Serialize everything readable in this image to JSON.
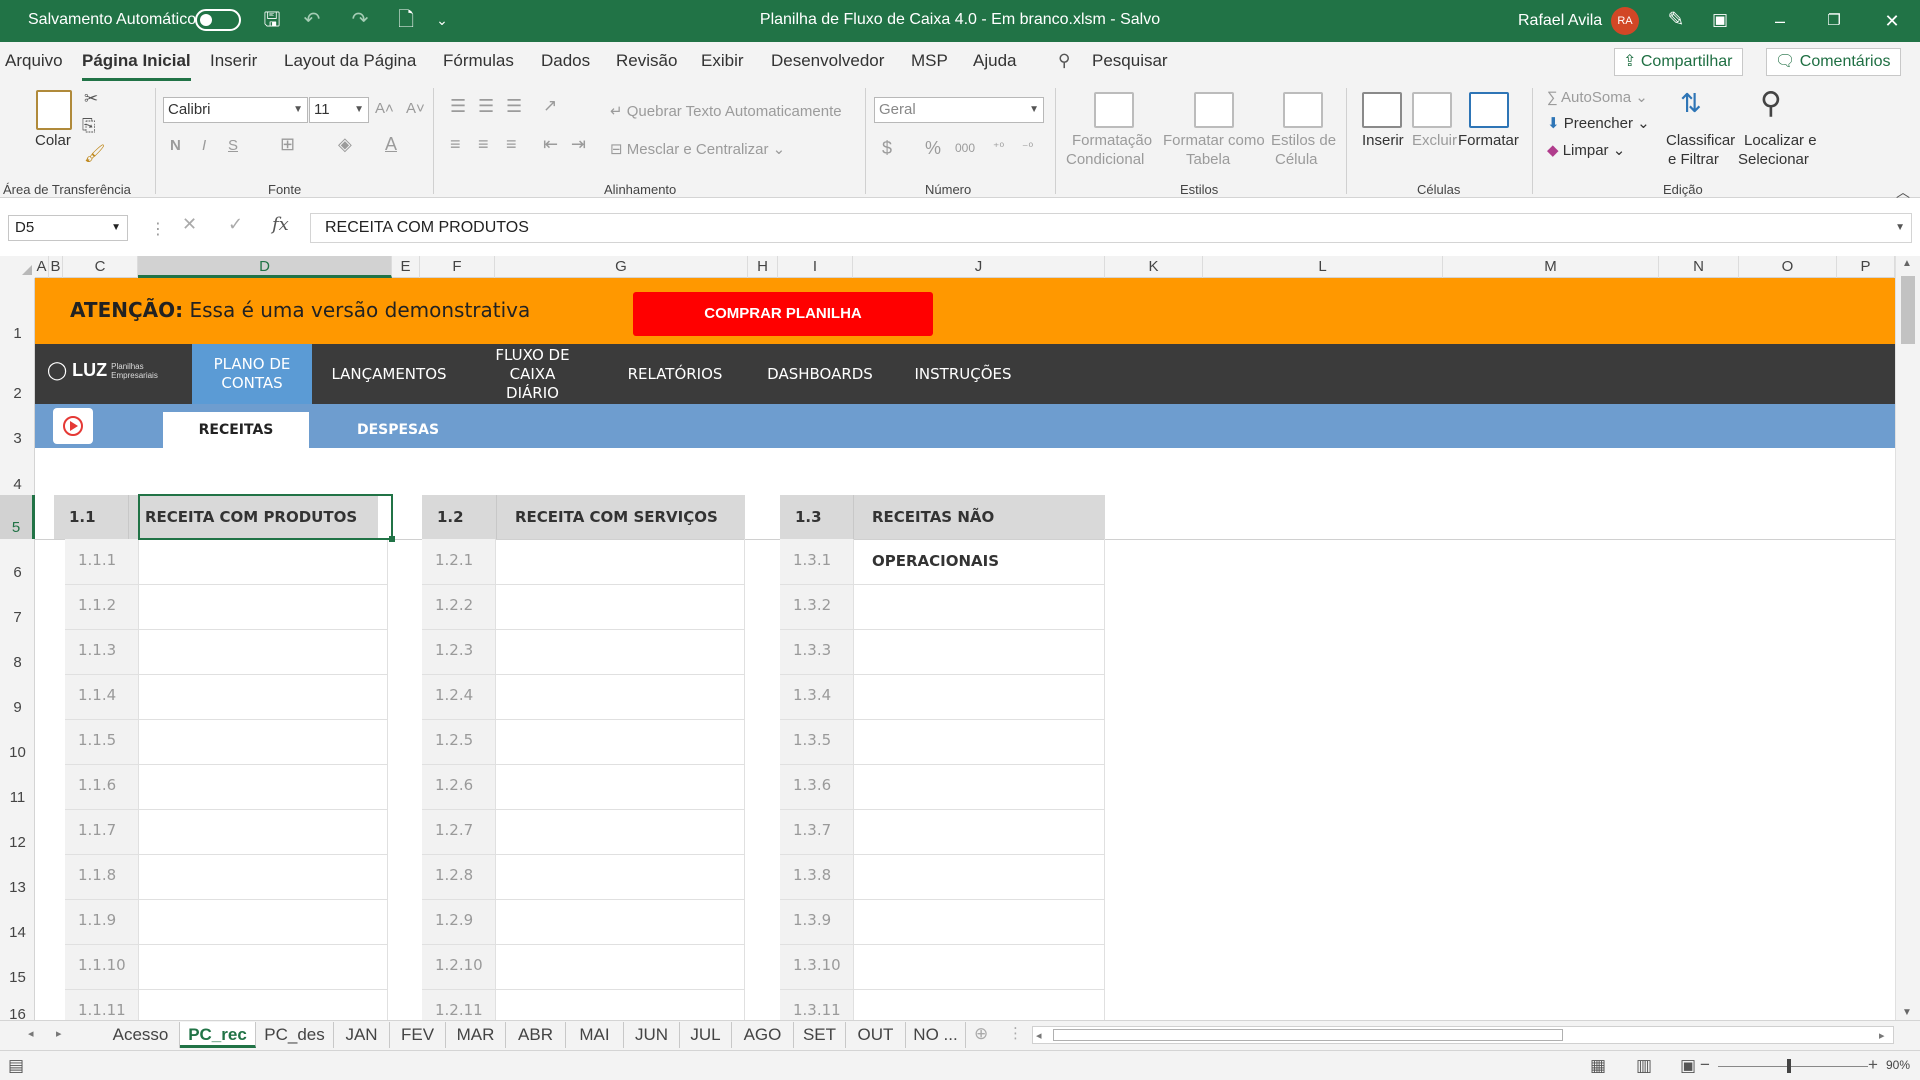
{
  "titlebar": {
    "autosave_label": "Salvamento Automático",
    "doc_title": "Planilha de Fluxo de Caixa 4.0 - Em branco.xlsm  -  Salvo",
    "user_name": "Rafael Avila",
    "avatar_initials": "RA",
    "colors": {
      "accent": "#217346",
      "avatar": "#d24726"
    }
  },
  "menu": {
    "items": [
      "Arquivo",
      "Página Inicial",
      "Inserir",
      "Layout da Página",
      "Fórmulas",
      "Dados",
      "Revisão",
      "Exibir",
      "Desenvolvedor",
      "MSP",
      "Ajuda"
    ],
    "active": "Página Inicial",
    "search_label": "Pesquisar",
    "share_label": "Compartilhar",
    "comments_label": "Comentários"
  },
  "ribbon": {
    "clipboard": {
      "paste_label": "Colar",
      "group_label": "Área de Transferência"
    },
    "font": {
      "family": "Calibri",
      "size": "11",
      "bold": "N",
      "italic": "I",
      "underline": "S",
      "group_label": "Fonte"
    },
    "alignment": {
      "wrap_label": "Quebrar Texto Automaticamente",
      "merge_label": "Mesclar e Centralizar",
      "group_label": "Alinhamento"
    },
    "number": {
      "format": "Geral",
      "currency": "$",
      "percent": "%",
      "thousands": "000",
      "group_label": "Número"
    },
    "styles": {
      "conditional_l1": "Formatação",
      "conditional_l2": "Condicional",
      "table_l1": "Formatar como",
      "table_l2": "Tabela",
      "cell_l1": "Estilos de",
      "cell_l2": "Célula",
      "group_label": "Estilos"
    },
    "cells": {
      "insert": "Inserir",
      "delete": "Excluir",
      "format": "Formatar",
      "group_label": "Células"
    },
    "editing": {
      "autosum": "AutoSoma",
      "fill": "Preencher",
      "clear": "Limpar",
      "sort_l1": "Classificar",
      "sort_l2": "e Filtrar",
      "find_l1": "Localizar e",
      "find_l2": "Selecionar",
      "group_label": "Edição"
    }
  },
  "formula_bar": {
    "name_box": "D5",
    "content": "RECEITA COM PRODUTOS",
    "fx": "fx"
  },
  "columns": [
    "A",
    "B",
    "C",
    "D",
    "E",
    "F",
    "G",
    "H",
    "I",
    "J",
    "K",
    "L",
    "M",
    "N",
    "O",
    "P"
  ],
  "rows": [
    "1",
    "2",
    "3",
    "4",
    "5",
    "6",
    "7",
    "8",
    "9",
    "10",
    "11",
    "12",
    "13",
    "14",
    "15",
    "16"
  ],
  "selected_column": "D",
  "selected_row": "5",
  "banner": {
    "attention_bold": "ATENÇÃO:",
    "attention_text": " Essa é uma versão demonstrativa",
    "buy_button": "COMPRAR PLANILHA",
    "color": "#ff9800",
    "button_color": "#ff0000"
  },
  "nav": {
    "logo": "LUZ",
    "logo_tag_l1": "Planilhas",
    "logo_tag_l2": "Empresariais",
    "items": [
      "PLANO DE CONTAS",
      "LANÇAMENTOS",
      "FLUXO DE CAIXA DIÁRIO",
      "RELATÓRIOS",
      "DASHBOARDS",
      "INSTRUÇÕES"
    ],
    "active": "PLANO DE CONTAS"
  },
  "subnav": {
    "tabs": [
      "RECEITAS",
      "DESPESAS"
    ],
    "active": "RECEITAS"
  },
  "tables": [
    {
      "code": "1.1",
      "title": "RECEITA COM PRODUTOS",
      "rows": [
        "1.1.1",
        "1.1.2",
        "1.1.3",
        "1.1.4",
        "1.1.5",
        "1.1.6",
        "1.1.7",
        "1.1.8",
        "1.1.9",
        "1.1.10",
        "1.1.11"
      ]
    },
    {
      "code": "1.2",
      "title": "RECEITA COM SERVIÇOS",
      "rows": [
        "1.2.1",
        "1.2.2",
        "1.2.3",
        "1.2.4",
        "1.2.5",
        "1.2.6",
        "1.2.7",
        "1.2.8",
        "1.2.9",
        "1.2.10",
        "1.2.11"
      ]
    },
    {
      "code": "1.3",
      "title": "RECEITAS NÃO OPERACIONAIS",
      "rows": [
        "1.3.1",
        "1.3.2",
        "1.3.3",
        "1.3.4",
        "1.3.5",
        "1.3.6",
        "1.3.7",
        "1.3.8",
        "1.3.9",
        "1.3.10",
        "1.3.11"
      ]
    }
  ],
  "sheet_tabs": {
    "items": [
      "Acesso",
      "PC_rec",
      "PC_des",
      "JAN",
      "FEV",
      "MAR",
      "ABR",
      "MAI",
      "JUN",
      "JUL",
      "AGO",
      "SET",
      "OUT",
      "NO ..."
    ],
    "active": "PC_rec"
  },
  "status": {
    "zoom": "90%",
    "zoom_minus": "−",
    "zoom_plus": "+"
  }
}
